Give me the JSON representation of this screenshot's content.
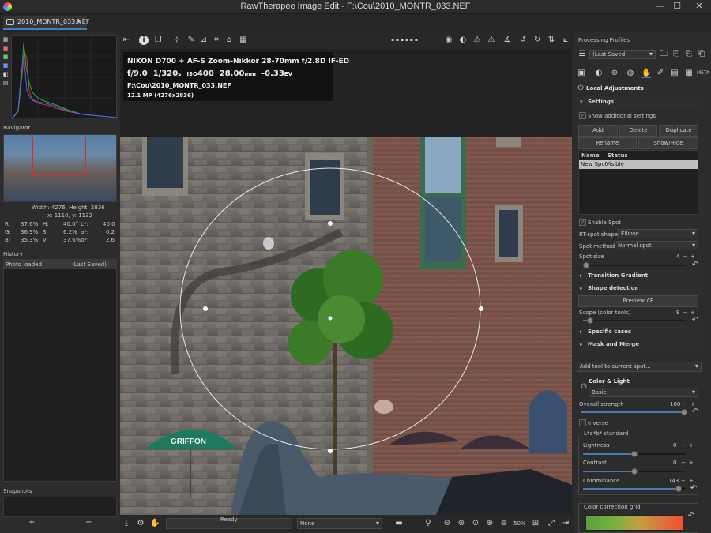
{
  "window": {
    "title": "RawTherapee Image Edit - F:\\Cou\\2010_MONTR_033.NEF"
  },
  "tab": {
    "label": "2010_MONTR_033.NEF",
    "close": "✕"
  },
  "navigator": {
    "title": "Navigator",
    "dims": "Width: 4276, Height: 2836",
    "coords": "x: 1110, y: 1132",
    "info": [
      [
        "R:",
        "37.6%",
        "H:",
        "40.0°",
        "L*:",
        "40.0"
      ],
      [
        "G:",
        "36.9%",
        "S:",
        "6.2%",
        "a*:",
        "0.2"
      ],
      [
        "B:",
        "35.3%",
        "V:",
        "37.6%",
        "b*:",
        "2.6"
      ]
    ]
  },
  "history": {
    "title": "History",
    "rows": [
      {
        "name": "Photo loaded",
        "value": "(Last Saved)"
      }
    ]
  },
  "snapshots": {
    "title": "Snapshots",
    "add": "+",
    "remove": "−"
  },
  "exif": {
    "line1": "NIKON D700 + AF-S Zoom-Nikkor 28-70mm f/2.8D IF-ED",
    "aperture": "f/9.0",
    "shutter": "1/320",
    "shutter_unit": "s",
    "iso_label": "ISO",
    "iso": "400",
    "focal": "28.00",
    "focal_unit": "mm",
    "ev": "-0.33",
    "ev_unit": "EV",
    "path": "F:\\Cou\\2010_MONTR_033.NEF",
    "mp": "12.1 MP (4276x2836)"
  },
  "image": {
    "griffon_text": "GRIFFON"
  },
  "statusbar": {
    "status": "Ready",
    "preset": "None",
    "zoom": "50%"
  },
  "right": {
    "profiles_title": "Processing Profiles",
    "profile_value": "(Last Saved)",
    "local_adj": "Local Adjustments",
    "settings": "Settings",
    "show_additional": "Show additional settings",
    "btn_add": "Add",
    "btn_delete": "Delete",
    "btn_duplicate": "Duplicate",
    "btn_rename": "Rename",
    "btn_showhide": "Show/Hide",
    "table_headers": [
      "Name",
      "Status"
    ],
    "table_rows": [
      {
        "name": "New Spot",
        "status": "Visible"
      }
    ],
    "enable_spot": "Enable Spot",
    "rt_spot_shape_label": "RT-spot shape:",
    "rt_spot_shape_value": "Ellipse",
    "spot_method_label": "Spot method:",
    "spot_method_value": "Normal spot",
    "spot_size_label": "Spot size",
    "spot_size_value": "4",
    "spot_size_fraction": 0.03,
    "transition_gradient": "Transition Gradient",
    "shape_detection": "Shape detection",
    "preview_de": "Preview ΔE",
    "scope_label": "Scope (color tools)",
    "scope_value": "9",
    "scope_fraction": 0.07,
    "specific_cases": "Specific cases",
    "mask_merge": "Mask and Merge",
    "add_tool": "Add tool to current spot...",
    "color_light": "Color & Light",
    "color_light_mode": "Basic",
    "overall_strength_label": "Overall strength",
    "overall_strength_value": "100",
    "overall_strength_fraction": 1.0,
    "inverse": "Inverse",
    "lab_standard": "L*a*b* standard",
    "lightness_label": "Lightness",
    "lightness_value": "0",
    "lightness_fraction": 0.5,
    "contrast_label": "Contrast",
    "contrast_value": "0",
    "contrast_fraction": 0.5,
    "chrominance_label": "Chrominance",
    "chrominance_value": "143",
    "chrominance_fraction": 0.93,
    "color_grid": "Color correction grid"
  },
  "colors": {
    "accent": "#3a7fd0",
    "slider_fill": "#4a78b8",
    "panel": "#2c2c2c",
    "dark": "#1f1f1f"
  }
}
